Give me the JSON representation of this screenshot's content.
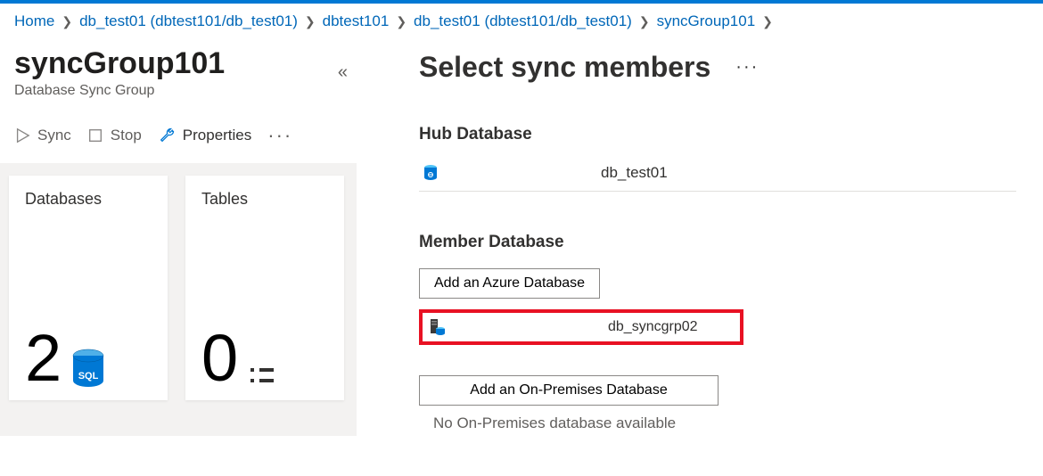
{
  "breadcrumb": {
    "home": "Home",
    "item1": "db_test01 (dbtest101/db_test01)",
    "item2": "dbtest101",
    "item3": "db_test01 (dbtest101/db_test01)",
    "item4": "syncGroup101"
  },
  "page": {
    "title": "syncGroup101",
    "subtitle": "Database Sync Group"
  },
  "cmd": {
    "sync": "Sync",
    "stop": "Stop",
    "properties": "Properties"
  },
  "cards": {
    "databases_label": "Databases",
    "databases_value": "2",
    "tables_label": "Tables",
    "tables_value": "0"
  },
  "panel": {
    "title": "Select sync members",
    "hub_section": "Hub Database",
    "hub_value": "db_test01",
    "member_section": "Member Database",
    "add_azure": "Add an Azure Database",
    "member_value": "db_syncgrp02",
    "add_onprem": "Add an On-Premises Database",
    "no_onprem": "No On-Premises database available"
  }
}
